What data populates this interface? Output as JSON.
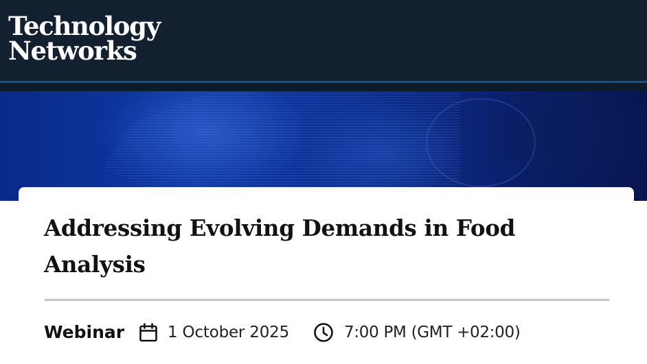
{
  "header": {
    "logo_line1": "Technology",
    "logo_line2": "Networks",
    "background": "#12202f",
    "accent": "#1f4f7f"
  },
  "banner": {
    "color": "#0f3aa6"
  },
  "event": {
    "title": "Addressing Evolving Demands in Food Analysis",
    "type": "Webinar",
    "date": "1 October 2025",
    "time": "7:00 PM (GMT +02:00)",
    "date_icon": "calendar-icon",
    "time_icon": "clock-icon"
  }
}
